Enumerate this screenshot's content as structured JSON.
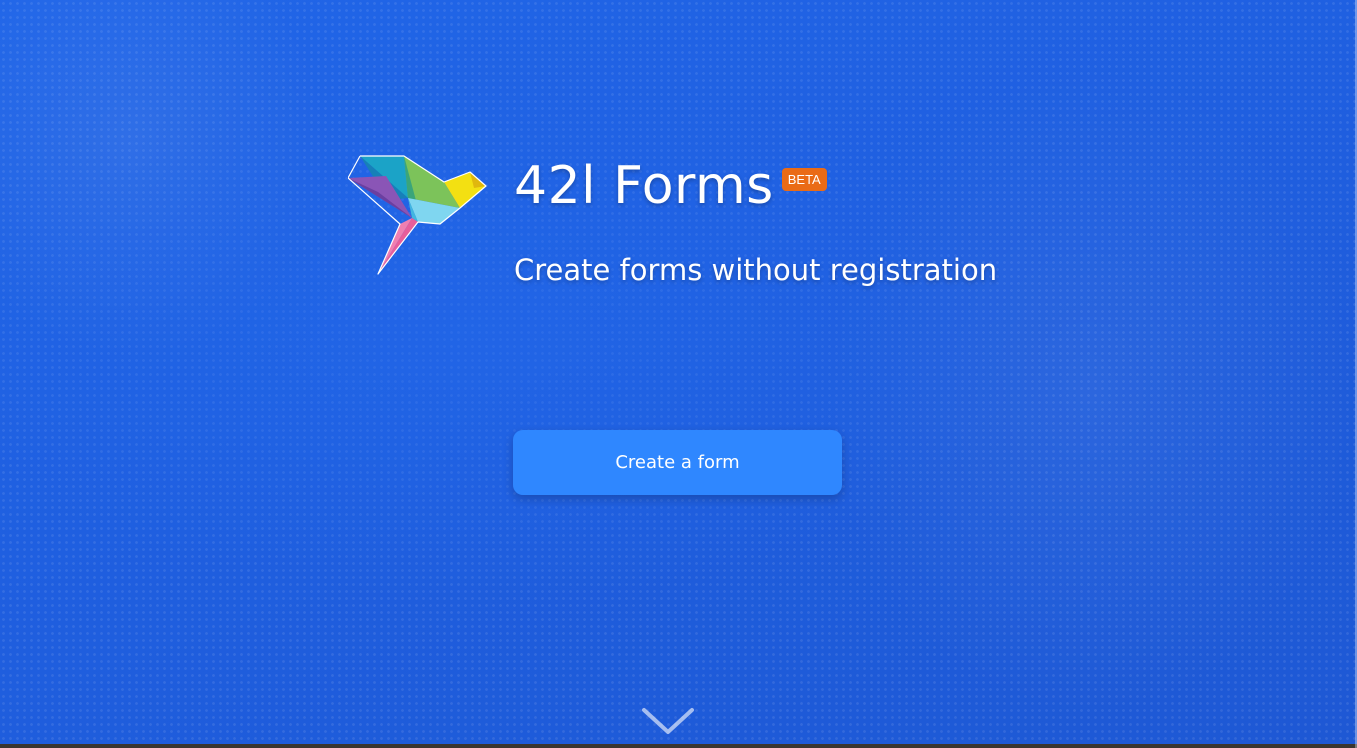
{
  "brand": {
    "title": "42l Forms",
    "badge": "BETA",
    "tagline": "Create forms without registration"
  },
  "actions": {
    "create_form_label": "Create a form"
  },
  "icons": {
    "logo": "origami-bird-logo-icon",
    "scroll": "chevron-down-icon"
  },
  "colors": {
    "background": "#1f5fe0",
    "button": "#2f87ff",
    "badge": "#ea6b16",
    "text": "#ffffff"
  }
}
